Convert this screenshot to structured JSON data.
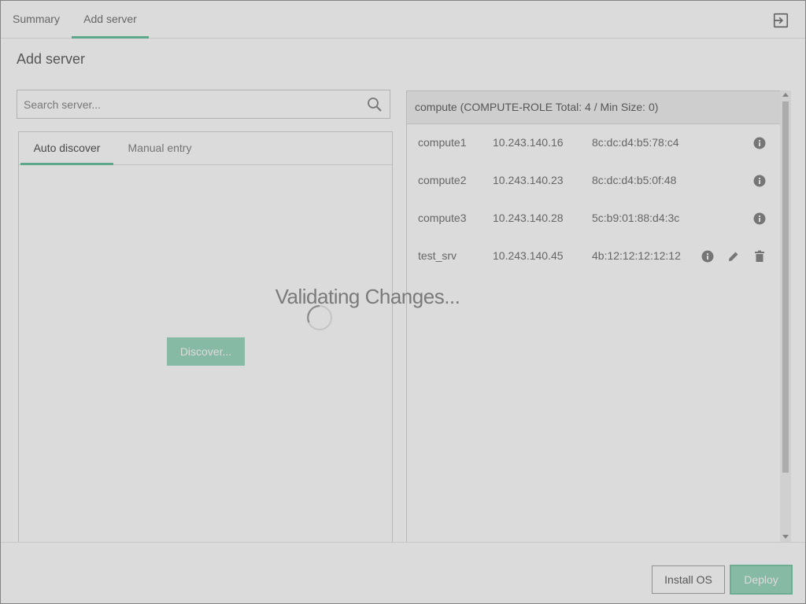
{
  "tabs": [
    {
      "label": "Summary",
      "active": false
    },
    {
      "label": "Add server",
      "active": true
    }
  ],
  "page_title": "Add server",
  "search": {
    "placeholder": "Search server..."
  },
  "left_panel": {
    "tabs": [
      {
        "label": "Auto discover",
        "active": true
      },
      {
        "label": "Manual entry",
        "active": false
      }
    ],
    "discover_label": "Discover..."
  },
  "right_panel": {
    "group_header": "compute (COMPUTE-ROLE Total: 4 / Min Size: 0)",
    "servers": [
      {
        "name": "compute1",
        "ip": "10.243.140.16",
        "mac": "8c:dc:d4:b5:78:c4"
      },
      {
        "name": "compute2",
        "ip": "10.243.140.23",
        "mac": "8c:dc:d4:b5:0f:48"
      },
      {
        "name": "compute3",
        "ip": "10.243.140.28",
        "mac": "5c:b9:01:88:d4:3c"
      },
      {
        "name": "test_srv",
        "ip": "10.243.140.45",
        "mac": "4b:12:12:12:12:12"
      }
    ]
  },
  "footer": {
    "install_label": "Install OS",
    "deploy_label": "Deploy"
  },
  "overlay": {
    "message": "Validating Changes..."
  },
  "colors": {
    "accent": "#6fc3a1",
    "button_fill": "#9ed9bf"
  },
  "icons": {
    "logout": "logout-icon",
    "search": "search-icon",
    "info": "info-icon",
    "edit": "pencil-icon",
    "delete": "trash-icon",
    "spinner": "spinner-icon"
  }
}
